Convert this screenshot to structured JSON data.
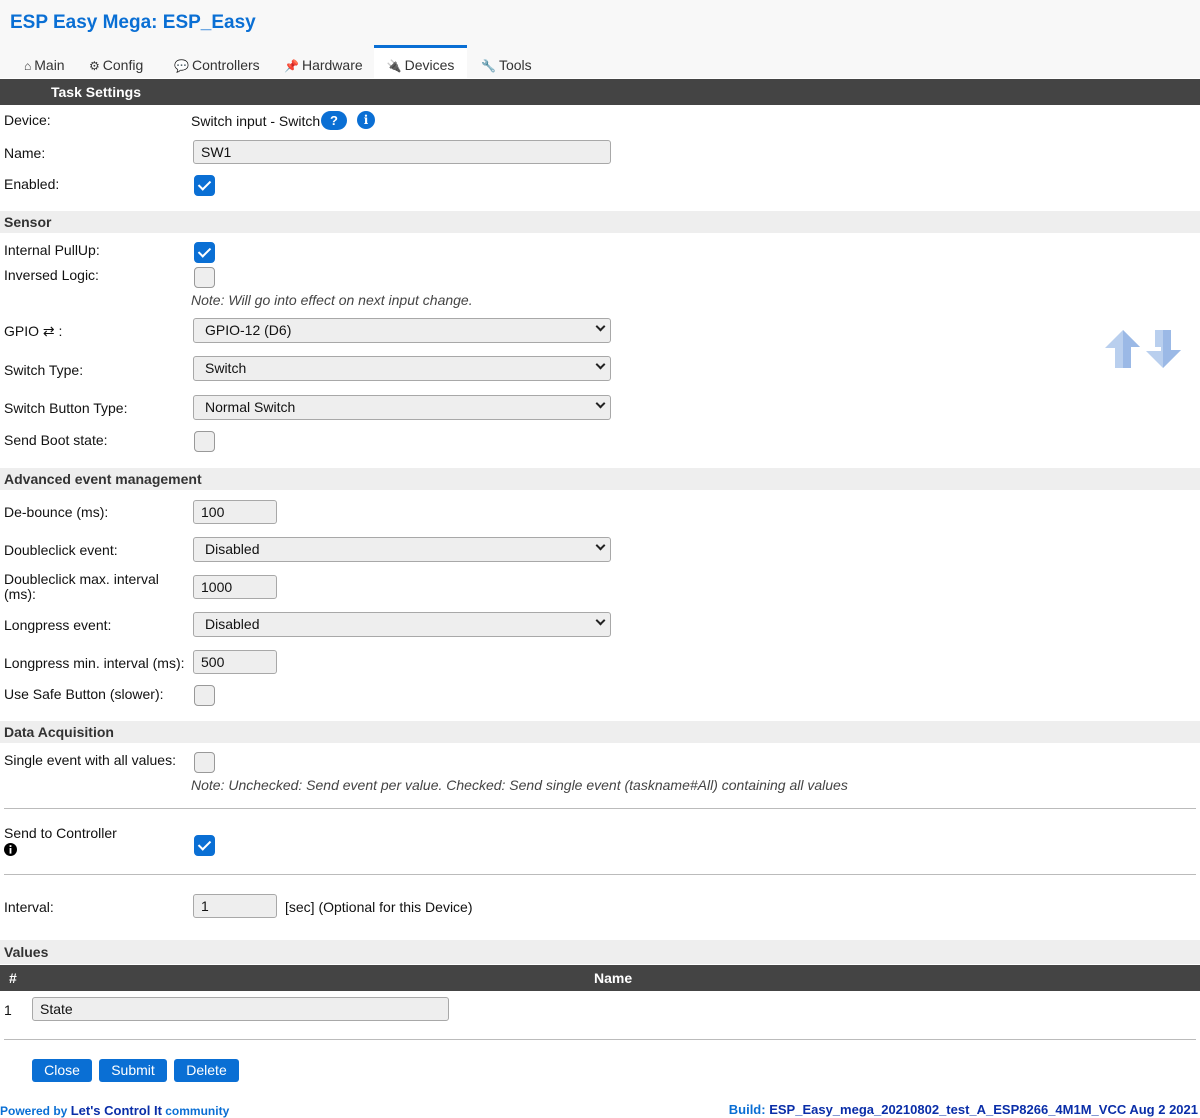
{
  "app_title": "ESP Easy Mega: ESP_Easy",
  "tabs": [
    {
      "icon": "⌂",
      "label": "Main"
    },
    {
      "icon": "⚙",
      "label": "Config"
    },
    {
      "icon": "💬",
      "label": "Controllers"
    },
    {
      "icon": "📌",
      "label": "Hardware"
    },
    {
      "icon": "🔌",
      "label": "Devices",
      "active": true
    },
    {
      "icon": "🔧",
      "label": "Tools"
    }
  ],
  "task_settings": {
    "title": "Task Settings",
    "device_label": "Device:",
    "device_value": "Switch input - Switch",
    "help_glyph": "?",
    "info_glyph": "i",
    "name_label": "Name:",
    "name_value": "SW1",
    "enabled_label": "Enabled:",
    "enabled_checked": true
  },
  "sensor": {
    "title": "Sensor",
    "pullup_label": "Internal PullUp:",
    "pullup_checked": true,
    "inversed_label": "Inversed Logic:",
    "inversed_checked": false,
    "note": "Note: Will go into effect on next input change.",
    "gpio_label": "GPIO ⇄ :",
    "gpio_value": "GPIO-12 (D6)",
    "switch_type_label": "Switch Type:",
    "switch_type_value": "Switch",
    "button_type_label": "Switch Button Type:",
    "button_type_value": "Normal Switch",
    "boot_state_label": "Send Boot state:",
    "boot_state_checked": false
  },
  "advanced": {
    "title": "Advanced event management",
    "debounce_label": "De-bounce (ms):",
    "debounce_value": "100",
    "doubleclick_label": "Doubleclick event:",
    "doubleclick_value": "Disabled",
    "dc_interval_label_1": "Doubleclick max. interval",
    "dc_interval_label_2": "(ms):",
    "dc_interval_value": "1000",
    "longpress_label": "Longpress event:",
    "longpress_value": "Disabled",
    "lp_interval_label": "Longpress min. interval (ms):",
    "lp_interval_value": "500",
    "safe_button_label": "Use Safe Button (slower):",
    "safe_button_checked": false
  },
  "data_acquisition": {
    "title": "Data Acquisition",
    "single_event_label": "Single event with all values:",
    "single_event_checked": false,
    "note": "Note: Unchecked: Send event per value. Checked: Send single event (taskname#All) containing all values",
    "send_controller_label": "Send to Controller",
    "send_controller_checked": true,
    "interval_label": "Interval:",
    "interval_value": "1",
    "interval_unit": "[sec] (Optional for this Device)"
  },
  "values": {
    "title": "Values",
    "col_num": "#",
    "col_name": "Name",
    "rows": [
      {
        "num": "1",
        "name": "State"
      }
    ]
  },
  "buttons": {
    "close": "Close",
    "submit": "Submit",
    "delete": "Delete"
  },
  "footer": {
    "powered_prefix": "Powered by",
    "powered_link": "Let's Control It",
    "powered_suffix": "community",
    "build_prefix": "Build:",
    "build_value": "ESP_Easy_mega_20210802_test_A_ESP8266_4M1M_VCC Aug 2 2021"
  },
  "colors": {
    "accent": "#0a6fd4",
    "dark_bar": "#444444",
    "section_band": "#eeeeee"
  }
}
